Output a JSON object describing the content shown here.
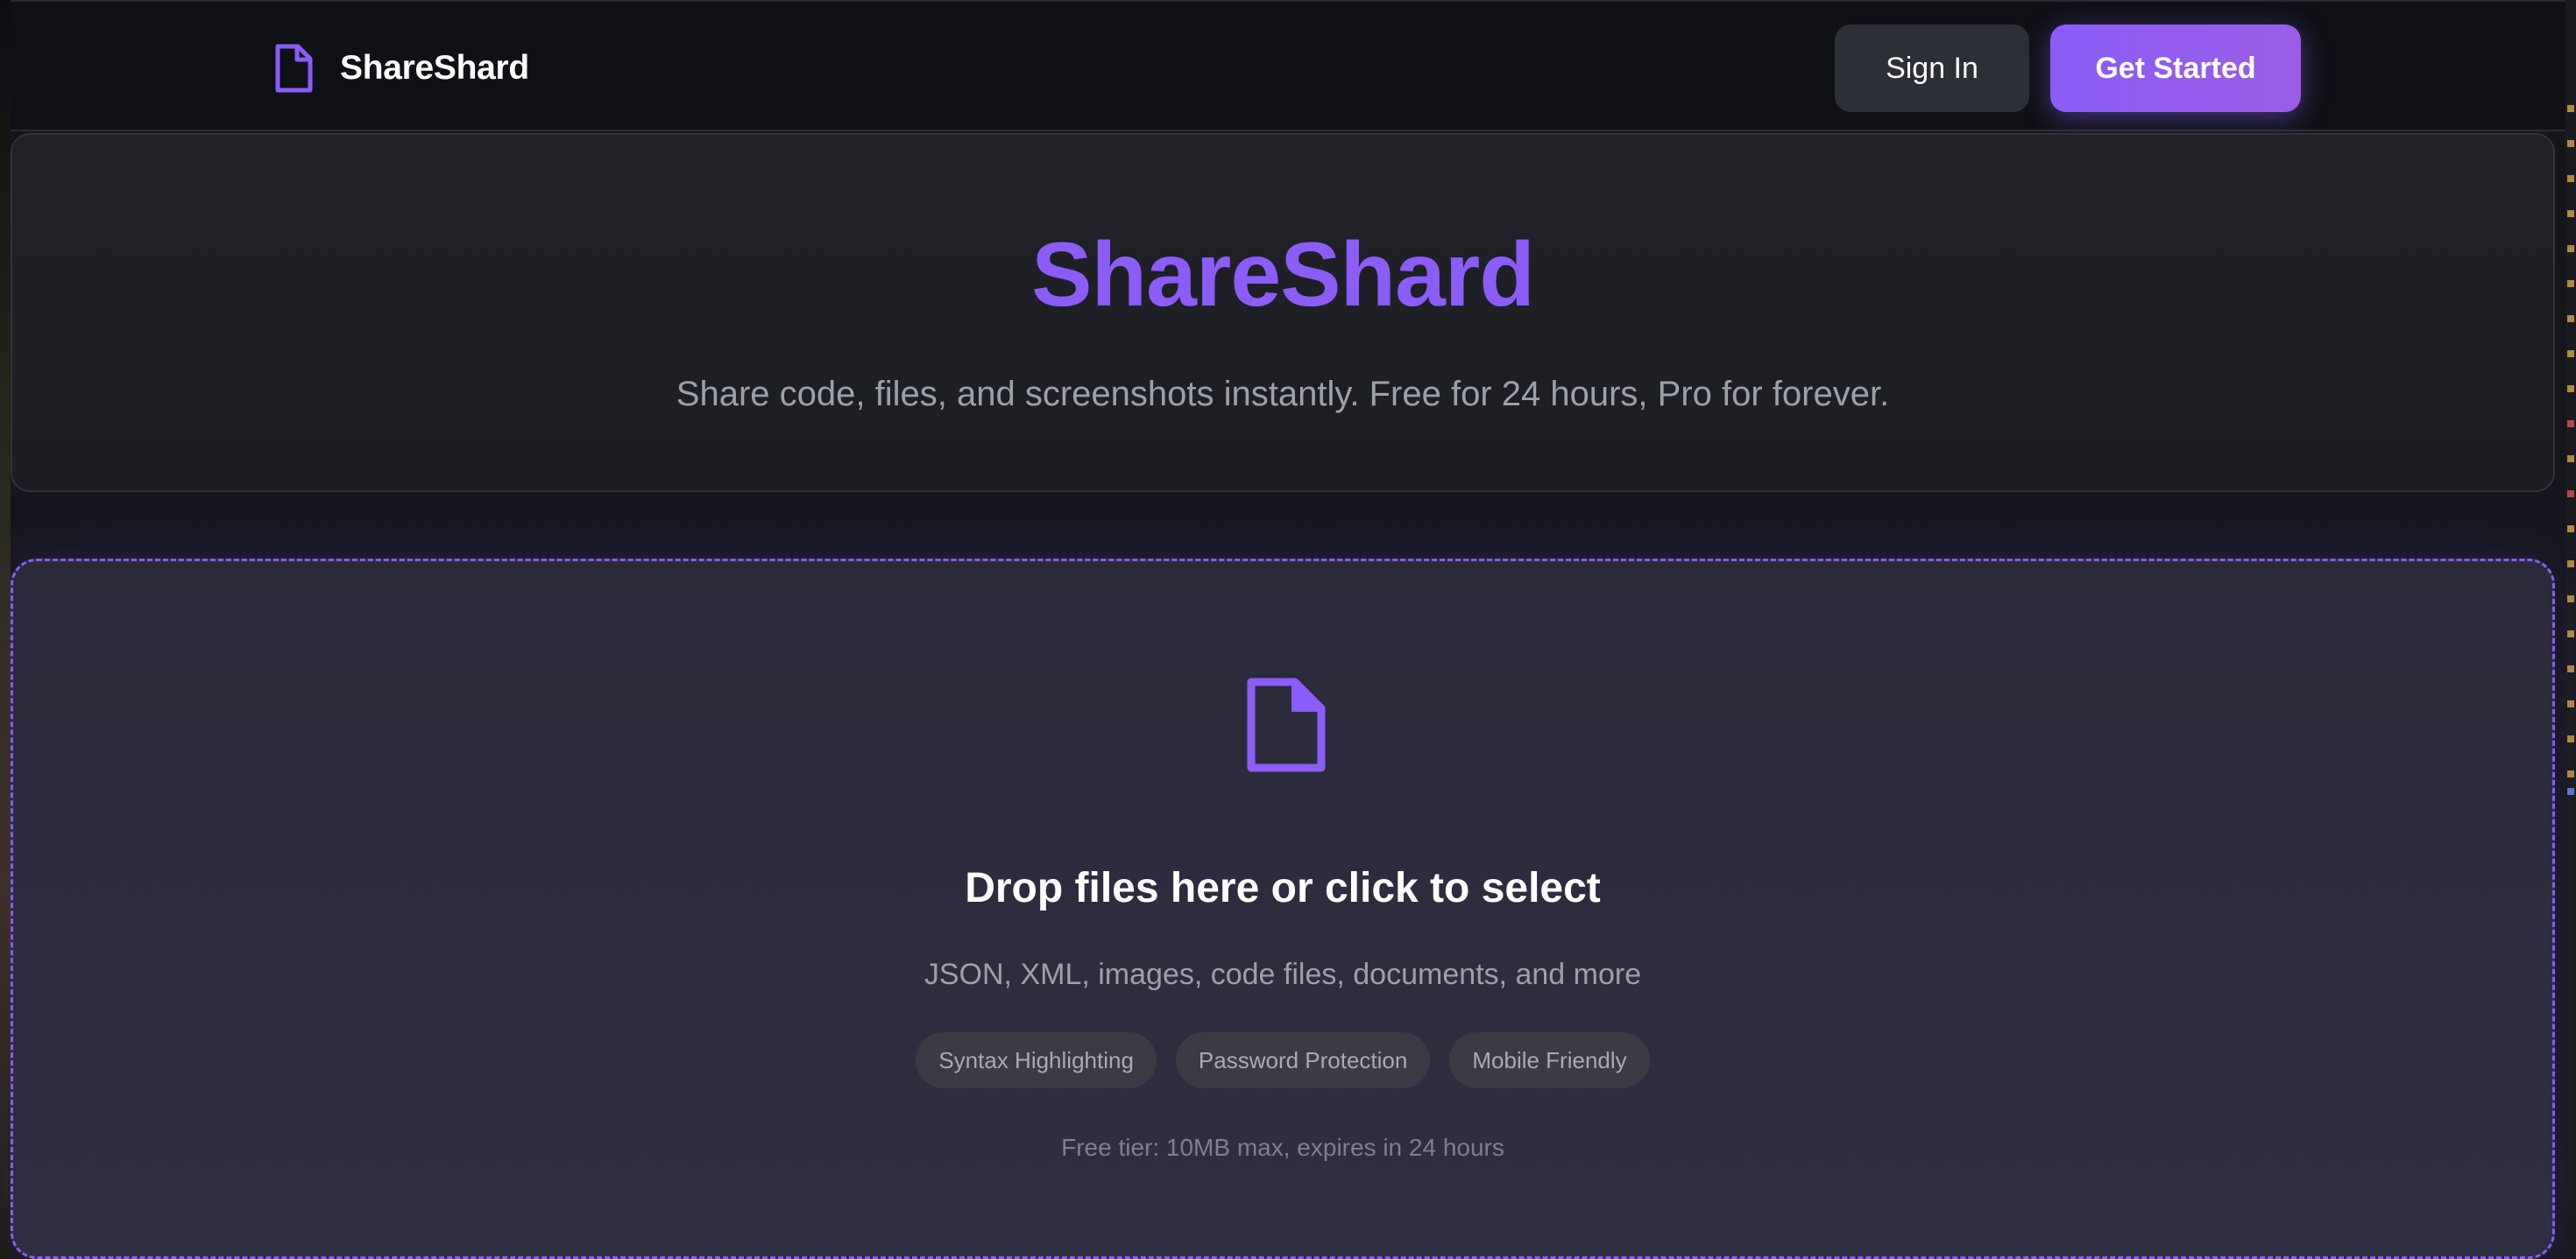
{
  "header": {
    "brand_icon": "file-icon",
    "brand_name": "ShareShard",
    "sign_in_label": "Sign In",
    "get_started_label": "Get Started"
  },
  "hero": {
    "title": "ShareShard",
    "subtitle": "Share code, files, and screenshots instantly. Free for 24 hours, Pro for forever."
  },
  "dropzone": {
    "icon": "file-icon",
    "title": "Drop files here or click to select",
    "subtitle": "JSON, XML, images, code files, documents, and more",
    "tags": [
      "Syntax Highlighting",
      "Password Protection",
      "Mobile Friendly"
    ],
    "note": "Free tier: 10MB max, expires in 24 hours"
  },
  "colors": {
    "accent": "#8b5cf6",
    "background": "#111318",
    "card": "#202227",
    "dropzone": "#2e2c3f"
  }
}
